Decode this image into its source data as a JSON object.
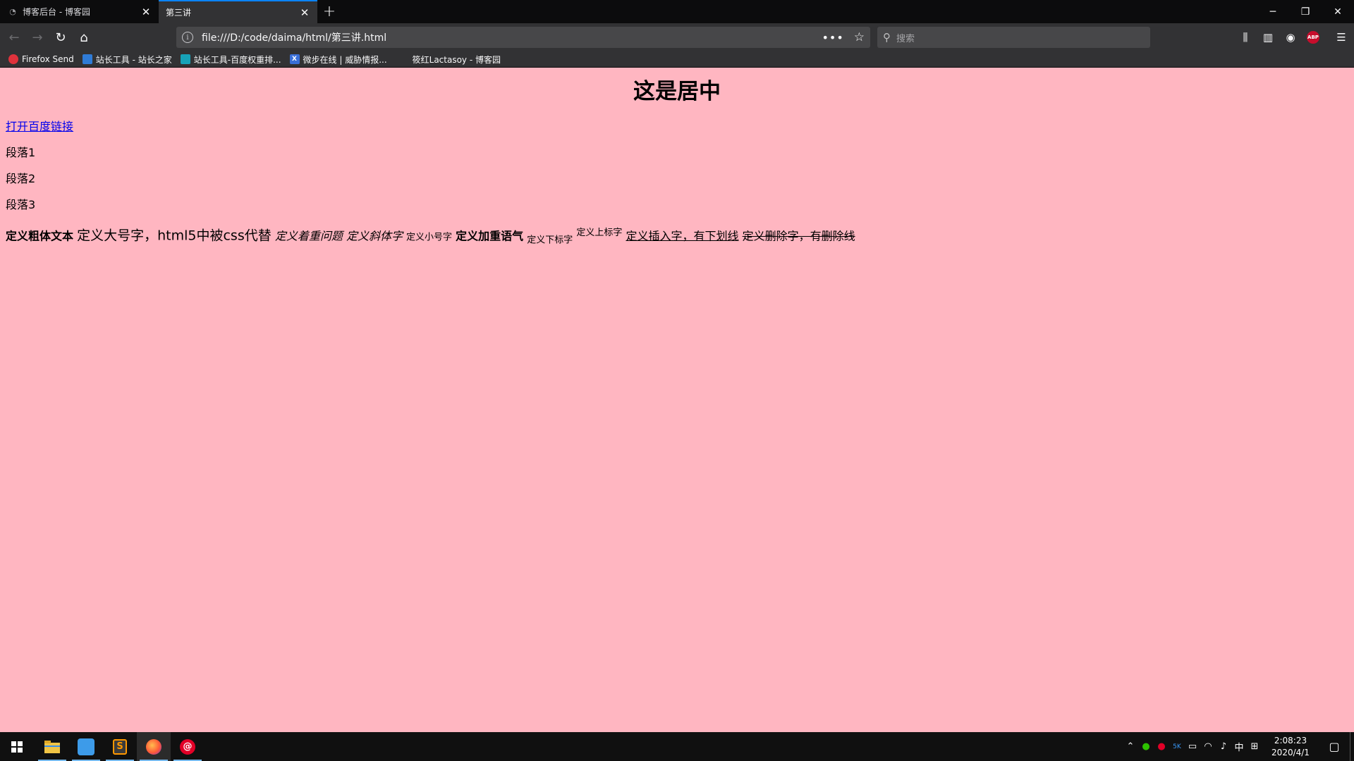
{
  "browser": {
    "tabs": [
      {
        "title": "博客后台 - 博客园",
        "active": false
      },
      {
        "title": "第三讲",
        "active": true
      }
    ],
    "address": "file:///D:/code/daima/html/第三讲.html",
    "search_placeholder": "搜索",
    "bookmarks": [
      {
        "label": "Firefox Send",
        "icon": "firefox-send-icon"
      },
      {
        "label": "站长工具 - 站长之家",
        "icon": "chinaz-icon"
      },
      {
        "label": "站长工具-百度权重排...",
        "icon": "aizhan-icon"
      },
      {
        "label": "微步在线 | 威胁情报...",
        "icon": "threatbook-icon"
      },
      {
        "label": "筱红Lactasoy - 博客园",
        "icon": ""
      }
    ],
    "abp_label": "ABP"
  },
  "page": {
    "background": "#ffb6c1",
    "heading": "这是居中",
    "link": "打开百度链接",
    "paragraphs": [
      "段落1",
      "段落2",
      "段落3"
    ],
    "inline": {
      "bold": "定义粗体文本",
      "big": "定义大号字，html5中被css代替",
      "em": "定义着重问题",
      "italic": "定义斜体字",
      "small": "定义小号字",
      "strong": "定义加重语气",
      "sub": "定义下标字",
      "sup": "定义上标字",
      "ins": "定义插入字，有下划线",
      "del": "定义删除字，有删除线"
    }
  },
  "taskbar": {
    "time": "2:08:23",
    "date": "2020/4/1",
    "ime": "中"
  }
}
